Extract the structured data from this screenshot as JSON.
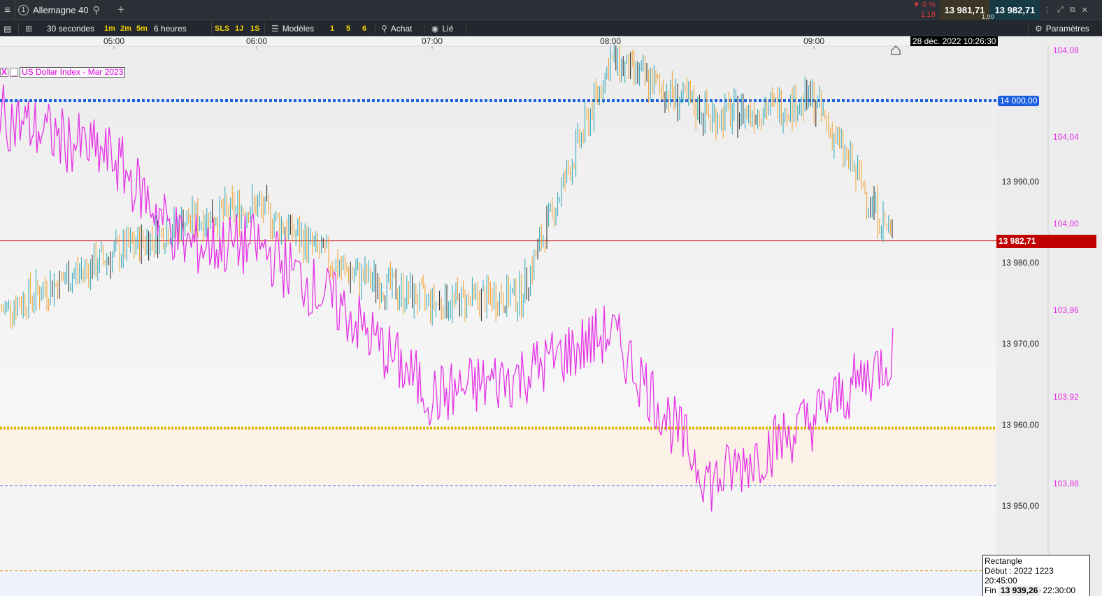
{
  "topbar": {
    "menu_icon": "hamburger-icon",
    "instrument_number": "1",
    "instrument": "Allemagne 40",
    "search_icon": "search-icon",
    "add_tab_icon": "plus-icon",
    "change_pct": "▼ 0 %",
    "change_abs": "1,18",
    "bid": "13 981,71",
    "ask": "13 982,71",
    "spread": "1,00",
    "win_icons": [
      "expand-icon",
      "popout-icon",
      "close-icon"
    ]
  },
  "toolbar": {
    "interval": "30 secondes",
    "quick_intervals": [
      "1m",
      "2m",
      "5m"
    ],
    "range": "6 heures",
    "quick_ranges": [
      "SLS",
      "1J",
      "1S"
    ],
    "templates": "Modèles",
    "quick_templates": [
      "1",
      "5",
      "6"
    ],
    "buy": "Achat",
    "linked": "Lié",
    "settings": "Paramètres"
  },
  "chart": {
    "time_labels": [
      "05:00",
      "06:00",
      "07:00",
      "08:00",
      "09:00"
    ],
    "datetime": "28 déc. 2022 10:26:30",
    "price_ticks": [
      "13 990,00",
      "13 980,00",
      "13 970,00",
      "13 960,00",
      "13 950,00"
    ],
    "price_min_visible": 13938.26,
    "price_bottom_partial": "13 939,26",
    "overlay_ticks": [
      "104,08",
      "104,04",
      "104,00",
      "103,96",
      "103,92",
      "103,88"
    ],
    "legend_close": "X",
    "legend_min": "_",
    "legend_name": "US Dollar Index - Mar 2023",
    "level_blue": "14 000,00",
    "level_blue_value": 14000,
    "current_price": "13 982,71",
    "current_price_value": 13982.71,
    "level_yellow_value": 13959.6,
    "level_blue_dash_value": 13952.5,
    "level_orange_dash_value": 13942.0,
    "colors": {
      "up": "#2aa6b8",
      "down": "#f0a030",
      "overlay": "#e632e6",
      "blue_line": "#1a5fe0",
      "price_line": "#cc2020",
      "price_tag": "#c00000",
      "yellow_line": "#d9b800"
    },
    "tooltip": {
      "title": "Rectangle",
      "start": "Début : 2022 1223 20:45:00",
      "end": "Fin :2022 1230 22:30:00"
    }
  },
  "chart_data": {
    "type": "line",
    "series": [
      {
        "name": "Allemagne 40",
        "unit": "points",
        "x": [
          "04:30",
          "05:00",
          "05:30",
          "06:00",
          "06:30",
          "07:00",
          "07:30",
          "08:00",
          "08:30",
          "09:00",
          "09:30"
        ],
        "values": [
          13974,
          13981,
          13985,
          13987,
          13979,
          13975,
          13976,
          14005,
          13998,
          14000,
          13982.71
        ]
      },
      {
        "name": "US Dollar Index - Mar 2023",
        "unit": "index",
        "x": [
          "04:30",
          "05:00",
          "05:30",
          "06:00",
          "06:30",
          "07:00",
          "07:30",
          "08:00",
          "08:30",
          "09:00",
          "09:30"
        ],
        "values": [
          104.05,
          104.03,
          103.99,
          103.99,
          103.96,
          103.92,
          103.93,
          103.95,
          103.88,
          103.91,
          103.94
        ]
      }
    ],
    "ylim_left": [
      13938.26,
      14008
    ],
    "ylim_right": [
      103.86,
      104.08
    ]
  }
}
